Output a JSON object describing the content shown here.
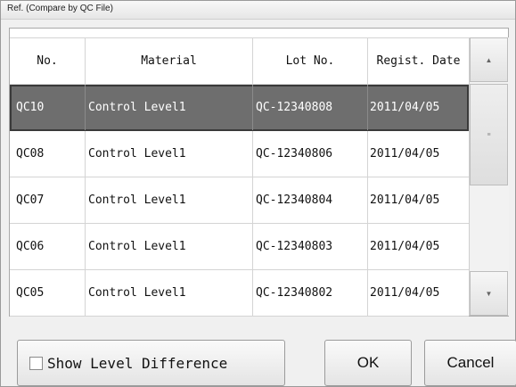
{
  "window": {
    "title": "Ref. (Compare by QC File)"
  },
  "table": {
    "headers": [
      "No.",
      "Material",
      "Lot No.",
      "Regist. Date"
    ],
    "rows": [
      {
        "no": "QC10",
        "material": "Control Level1",
        "lot": "QC-12340808",
        "date": "2011/04/05",
        "selected": true
      },
      {
        "no": "QC08",
        "material": "Control Level1",
        "lot": "QC-12340806",
        "date": "2011/04/05",
        "selected": false
      },
      {
        "no": "QC07",
        "material": "Control Level1",
        "lot": "QC-12340804",
        "date": "2011/04/05",
        "selected": false
      },
      {
        "no": "QC06",
        "material": "Control Level1",
        "lot": "QC-12340803",
        "date": "2011/04/05",
        "selected": false
      },
      {
        "no": "QC05",
        "material": "Control Level1",
        "lot": "QC-12340802",
        "date": "2011/04/05",
        "selected": false
      }
    ]
  },
  "scrollbar": {
    "up_icon": "▲",
    "down_icon": "▼",
    "thumb_grip_icon": "≡"
  },
  "footer": {
    "show_level_difference_label": "Show Level Difference",
    "show_level_difference_checked": false,
    "ok_label": "OK",
    "cancel_label": "Cancel"
  },
  "colors": {
    "selected_row": "#6e6e6e",
    "selected_text": "#ffffff"
  }
}
